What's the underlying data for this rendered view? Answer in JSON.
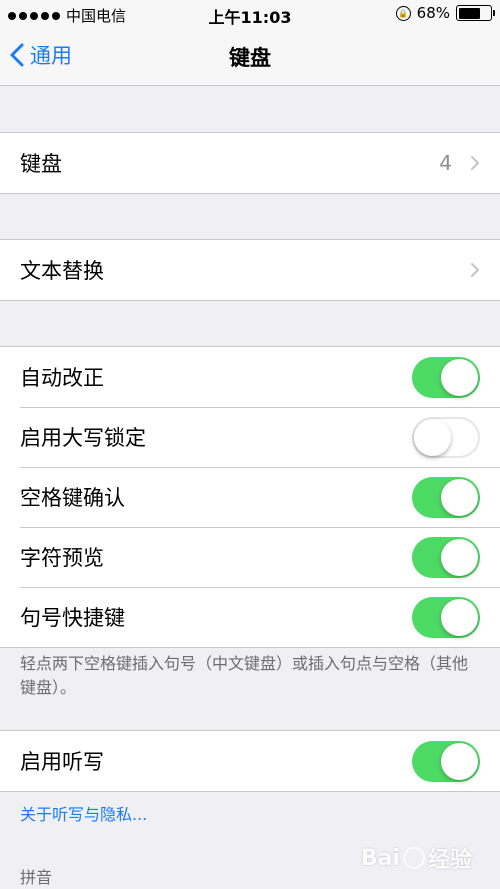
{
  "status_bar": {
    "carrier": "中国电信",
    "time": "上午11:03",
    "battery": "68%",
    "battery_level": 0.68
  },
  "nav": {
    "back_label": "通用",
    "title": "键盘"
  },
  "groups": {
    "keyboards": {
      "label": "键盘",
      "value": "4"
    },
    "text_replacement": {
      "label": "文本替换"
    },
    "auto_correct": {
      "label": "自动改正",
      "on": true
    },
    "caps_lock": {
      "label": "启用大写锁定",
      "on": false
    },
    "space_confirm": {
      "label": "空格键确认",
      "on": true
    },
    "char_preview": {
      "label": "字符预览",
      "on": true
    },
    "period_shortcut": {
      "label": "句号快捷键",
      "on": true
    },
    "period_note": "轻点两下空格键插入句号（中文键盘）或插入句点与空格（其他键盘）。",
    "dictation": {
      "label": "启用听写",
      "on": true
    },
    "dictation_privacy_link": "关于听写与隐私...",
    "pinyin_header": "拼音"
  },
  "watermark": {
    "text_left": "Bai",
    "text_right": "经验"
  },
  "colors": {
    "accent": "#1a7cf5",
    "switch_on": "#4cd964",
    "background": "#efeff4"
  }
}
